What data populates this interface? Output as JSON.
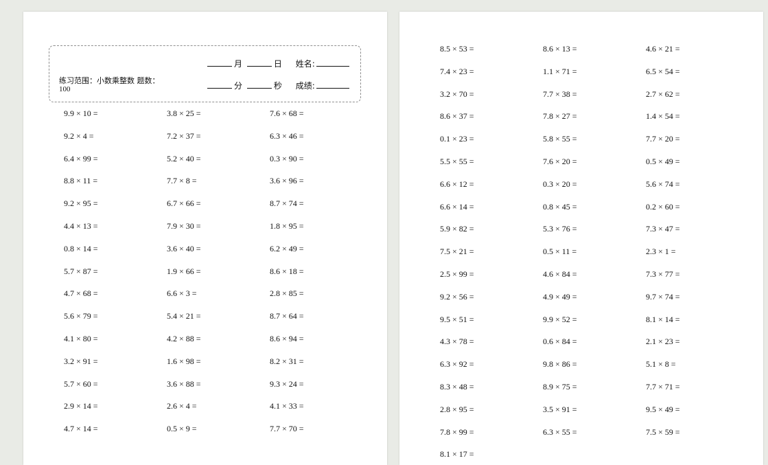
{
  "header": {
    "month_label": "月",
    "day_label": "日",
    "name_label": "姓名:",
    "minute_label": "分",
    "second_label": "秒",
    "score_label": "成绩:",
    "range_text": "练习范围：小数乘整数  题数：",
    "count_value": "100"
  },
  "page1_columns": [
    [
      "9.9 × 10 =",
      "9.2 × 4 =",
      "6.4 × 99 =",
      "8.8 × 11 =",
      "9.2 × 95 =",
      "4.4 × 13 =",
      "0.8 × 14 =",
      "5.7 × 87 =",
      "4.7 × 68 =",
      "5.6 × 79 =",
      "4.1 × 80 =",
      "3.2 × 91 =",
      "5.7 × 60 =",
      "2.9 × 14 =",
      "4.7 × 14 ="
    ],
    [
      "3.8 × 25 =",
      "7.2 × 37 =",
      "5.2 × 40 =",
      "7.7 × 8 =",
      "6.7 × 66 =",
      "7.9 × 30 =",
      "3.6 × 40 =",
      "1.9 × 66 =",
      "6.6 × 3 =",
      "5.4 × 21 =",
      "4.2 × 88 =",
      "1.6 × 98 =",
      "3.6 × 88 =",
      "2.6 × 4 =",
      "0.5 × 9 ="
    ],
    [
      "7.6 × 68 =",
      "6.3 × 46 =",
      "0.3 × 90 =",
      "3.6 × 96 =",
      "8.7 × 74 =",
      "1.8 × 95 =",
      "6.2 × 49 =",
      "8.6 × 18 =",
      "2.8 × 85 =",
      "8.7 × 64 =",
      "8.6 × 94 =",
      "8.2 × 31 =",
      "9.3 × 24 =",
      "4.1 × 33 =",
      "7.7 × 70 ="
    ]
  ],
  "page2_columns": [
    [
      "8.5 × 53 =",
      "7.4 × 23 =",
      "3.2 × 70 =",
      "8.6 × 37 =",
      "0.1 × 23 =",
      "5.5 × 55 =",
      "6.6 × 12 =",
      "6.6 × 14 =",
      "5.9 × 82 =",
      "7.5 × 21 =",
      "2.5 × 99 =",
      "9.2 × 56 =",
      "9.5 × 51 =",
      "4.3 × 78 =",
      "6.3 × 92 =",
      "8.3 × 48 =",
      "2.8 × 95 =",
      "7.8 × 99 =",
      "8.1 × 17 ="
    ],
    [
      "8.6 × 13 =",
      "1.1 × 71 =",
      "7.7 × 38 =",
      "7.8 × 27 =",
      "5.8 × 55 =",
      "7.6 × 20 =",
      "0.3 × 20 =",
      "0.8 × 45 =",
      "5.3 × 76 =",
      "0.5 × 11 =",
      "4.6 × 84 =",
      "4.9 × 49 =",
      "9.9 × 52 =",
      "0.6 × 84 =",
      "9.8 × 86 =",
      "8.9 × 75 =",
      "3.5 × 91 =",
      "6.3 × 55 ="
    ],
    [
      "4.6 × 21 =",
      "6.5 × 54 =",
      "2.7 × 62 =",
      "1.4 × 54 =",
      "7.7 × 20 =",
      "0.5 × 49 =",
      "5.6 × 74 =",
      "0.2 × 60 =",
      "7.3 × 47 =",
      "2.3 × 1 =",
      "7.3 × 77 =",
      "9.7 × 74 =",
      "8.1 × 14 =",
      "2.1 × 23 =",
      "5.1 × 8 =",
      "7.7 × 71 =",
      "9.5 × 49 =",
      "7.5 × 59 ="
    ]
  ]
}
